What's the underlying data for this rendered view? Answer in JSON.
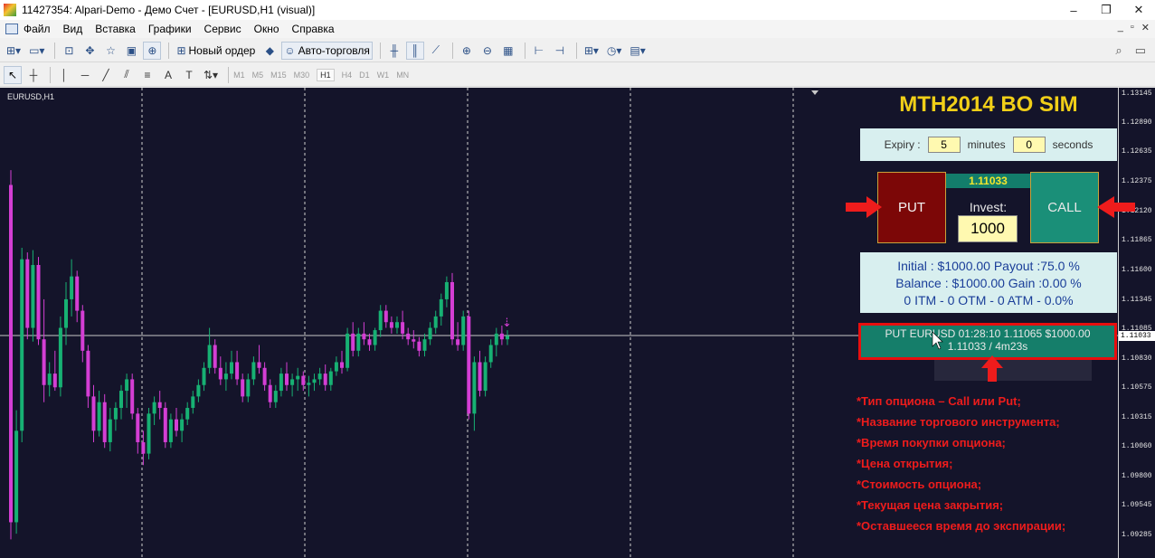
{
  "window": {
    "title": "11427354: Alpari-Demo - Демо Счет - [EURUSD,H1 (visual)]",
    "controls": [
      "–",
      "❐",
      "✕"
    ]
  },
  "menu": {
    "items": [
      "Файл",
      "Вид",
      "Вставка",
      "Графики",
      "Сервис",
      "Окно",
      "Справка"
    ],
    "right": [
      "_",
      "▫",
      "✕"
    ]
  },
  "toolbar": {
    "new_order": "Новый ордер",
    "auto_trading": "Авто-торговля",
    "periods": [
      "M1",
      "M5",
      "M15",
      "M30",
      "H1",
      "H4",
      "D1",
      "W1",
      "MN"
    ],
    "active_period": "H1"
  },
  "chart": {
    "symbol": "EURUSD,H1",
    "current_price": "1.11033",
    "price_ticks": [
      "1.13145",
      "1.12890",
      "1.12635",
      "1.12375",
      "1.12120",
      "1.11865",
      "1.11600",
      "1.11345",
      "1.11085",
      "1.10830",
      "1.10575",
      "1.10315",
      "1.10060",
      "1.09800",
      "1.09545",
      "1.09285"
    ],
    "colors": {
      "background": "#14142a",
      "bull": "#17b173",
      "bear": "#d43ed4",
      "grid": "#cfcfcf"
    },
    "candles": [
      [
        1.1235,
        1.1248,
        1.0925,
        1.094
      ],
      [
        1.094,
        1.1038,
        1.093,
        1.102
      ],
      [
        1.102,
        1.118,
        1.101,
        1.117
      ],
      [
        1.117,
        1.1176,
        1.11,
        1.111
      ],
      [
        1.111,
        1.1178,
        1.1098,
        1.1165
      ],
      [
        1.1165,
        1.1172,
        1.1095,
        1.11
      ],
      [
        1.11,
        1.1135,
        1.1045,
        1.106
      ],
      [
        1.106,
        1.108,
        1.105,
        1.107
      ],
      [
        1.107,
        1.109,
        1.1055,
        1.1058
      ],
      [
        1.1058,
        1.112,
        1.105,
        1.111
      ],
      [
        1.111,
        1.115,
        1.1095,
        1.1135
      ],
      [
        1.1135,
        1.117,
        1.112,
        1.1155
      ],
      [
        1.1155,
        1.116,
        1.1115,
        1.1125
      ],
      [
        1.1125,
        1.113,
        1.108,
        1.109
      ],
      [
        1.109,
        1.1095,
        1.104,
        1.105
      ],
      [
        1.105,
        1.106,
        1.101,
        1.102
      ],
      [
        1.102,
        1.1055,
        1.1015,
        1.1045
      ],
      [
        1.1045,
        1.1052,
        1.1005,
        1.101
      ],
      [
        1.101,
        1.104,
        1.1002,
        1.103
      ],
      [
        1.103,
        1.1045,
        1.102,
        1.104
      ],
      [
        1.104,
        1.106,
        1.103,
        1.1055
      ],
      [
        1.1055,
        1.107,
        1.104,
        1.1065
      ],
      [
        1.1065,
        1.107,
        1.103,
        1.1035
      ],
      [
        1.1035,
        1.104,
        1.1,
        1.101
      ],
      [
        1.101,
        1.102,
        1.099,
        1.1
      ],
      [
        1.1,
        1.104,
        1.0995,
        1.1035
      ],
      [
        1.1035,
        1.105,
        1.1025,
        1.1045
      ],
      [
        1.1045,
        1.1055,
        1.103,
        1.104
      ],
      [
        1.104,
        1.1045,
        1.1005,
        1.101
      ],
      [
        1.101,
        1.1035,
        1.1005,
        1.103
      ],
      [
        1.103,
        1.104,
        1.1015,
        1.102
      ],
      [
        1.102,
        1.1035,
        1.101,
        1.103
      ],
      [
        1.103,
        1.1045,
        1.1025,
        1.104
      ],
      [
        1.104,
        1.1055,
        1.1035,
        1.105
      ],
      [
        1.105,
        1.1065,
        1.1045,
        1.106
      ],
      [
        1.106,
        1.108,
        1.1055,
        1.1075
      ],
      [
        1.1075,
        1.111,
        1.107,
        1.1095
      ],
      [
        1.1095,
        1.11,
        1.107,
        1.1075
      ],
      [
        1.1075,
        1.1085,
        1.106,
        1.1065
      ],
      [
        1.1065,
        1.108,
        1.1055,
        1.107
      ],
      [
        1.107,
        1.109,
        1.1065,
        1.108
      ],
      [
        1.108,
        1.109,
        1.106,
        1.1065
      ],
      [
        1.1065,
        1.107,
        1.1045,
        1.105
      ],
      [
        1.105,
        1.107,
        1.1045,
        1.1065
      ],
      [
        1.1065,
        1.1085,
        1.106,
        1.108
      ],
      [
        1.108,
        1.1095,
        1.107,
        1.1075
      ],
      [
        1.1075,
        1.108,
        1.1055,
        1.106
      ],
      [
        1.106,
        1.1065,
        1.104,
        1.1045
      ],
      [
        1.1045,
        1.106,
        1.104,
        1.1055
      ],
      [
        1.1055,
        1.1075,
        1.105,
        1.107
      ],
      [
        1.107,
        1.108,
        1.1055,
        1.106
      ],
      [
        1.106,
        1.107,
        1.105,
        1.1065
      ],
      [
        1.1065,
        1.1075,
        1.1055,
        1.1068
      ],
      [
        1.1068,
        1.1072,
        1.1055,
        1.106
      ],
      [
        1.106,
        1.1068,
        1.105,
        1.1062
      ],
      [
        1.1062,
        1.107,
        1.1055,
        1.1065
      ],
      [
        1.1065,
        1.1075,
        1.106,
        1.107
      ],
      [
        1.107,
        1.1078,
        1.1055,
        1.106
      ],
      [
        1.106,
        1.1075,
        1.1055,
        1.1072
      ],
      [
        1.1072,
        1.1085,
        1.1068,
        1.108
      ],
      [
        1.108,
        1.109,
        1.107,
        1.1075
      ],
      [
        1.1075,
        1.111,
        1.1072,
        1.1105
      ],
      [
        1.1105,
        1.1115,
        1.1085,
        1.109
      ],
      [
        1.109,
        1.111,
        1.1085,
        1.1105
      ],
      [
        1.1105,
        1.1115,
        1.1095,
        1.11
      ],
      [
        1.11,
        1.1105,
        1.109,
        1.1095
      ],
      [
        1.1095,
        1.111,
        1.109,
        1.1108
      ],
      [
        1.1108,
        1.113,
        1.1102,
        1.1125
      ],
      [
        1.1125,
        1.113,
        1.111,
        1.1115
      ],
      [
        1.1115,
        1.112,
        1.1105,
        1.111
      ],
      [
        1.111,
        1.112,
        1.1105,
        1.1115
      ],
      [
        1.1115,
        1.1125,
        1.11,
        1.1105
      ],
      [
        1.1105,
        1.111,
        1.1095,
        1.11
      ],
      [
        1.11,
        1.1108,
        1.1092,
        1.1098
      ],
      [
        1.1098,
        1.1102,
        1.1085,
        1.109
      ],
      [
        1.109,
        1.1105,
        1.1085,
        1.11
      ],
      [
        1.11,
        1.1115,
        1.1095,
        1.111
      ],
      [
        1.111,
        1.1125,
        1.1105,
        1.112
      ],
      [
        1.112,
        1.114,
        1.1112,
        1.1135
      ],
      [
        1.1135,
        1.1155,
        1.1128,
        1.115
      ],
      [
        1.115,
        1.1158,
        1.1095,
        1.11
      ],
      [
        1.11,
        1.1115,
        1.109,
        1.1095
      ],
      [
        1.1095,
        1.1125,
        1.109,
        1.112
      ],
      [
        1.112,
        1.1125,
        1.103,
        1.1035
      ],
      [
        1.1035,
        1.1085,
        1.102,
        1.108
      ],
      [
        1.108,
        1.109,
        1.105,
        1.1055
      ],
      [
        1.1055,
        1.1085,
        1.105,
        1.108
      ],
      [
        1.108,
        1.11,
        1.1075,
        1.1095
      ],
      [
        1.1095,
        1.111,
        1.1085,
        1.1105
      ],
      [
        1.1105,
        1.1112,
        1.1095,
        1.11
      ],
      [
        1.11,
        1.1108,
        1.1095,
        1.1103
      ]
    ]
  },
  "panel": {
    "title": "MTH2014 BO SIM",
    "expiry_label": "Expiry :",
    "expiry_minutes": "5",
    "minutes_label": "minutes",
    "expiry_seconds": "0",
    "seconds_label": "seconds",
    "put_label": "PUT",
    "call_label": "CALL",
    "price": "1.11033",
    "invest_label": "Invest:",
    "invest_value": "1000",
    "stats": [
      "Initial : $1000.00 Payout :75.0 %",
      "Balance : $1000.00 Gain :0.00 %",
      "0 ITM - 0 OTM - 0 ATM - 0.0%"
    ],
    "order_line1": "PUT EURUSD 01:28:10 1.11065 $1000.00",
    "order_line2": "1.11033 / 4m23s"
  },
  "annotations": {
    "notes": [
      "*Тип опциона – Call или Put;",
      "*Название торгового инструмента;",
      "*Время покупки опциона;",
      "*Цена открытия;",
      "*Стоимость опциона;",
      "*Текущая цена закрытия;",
      "*Оставшееся время до экспирации;"
    ],
    "arrow_color": "#ee1c1c"
  }
}
